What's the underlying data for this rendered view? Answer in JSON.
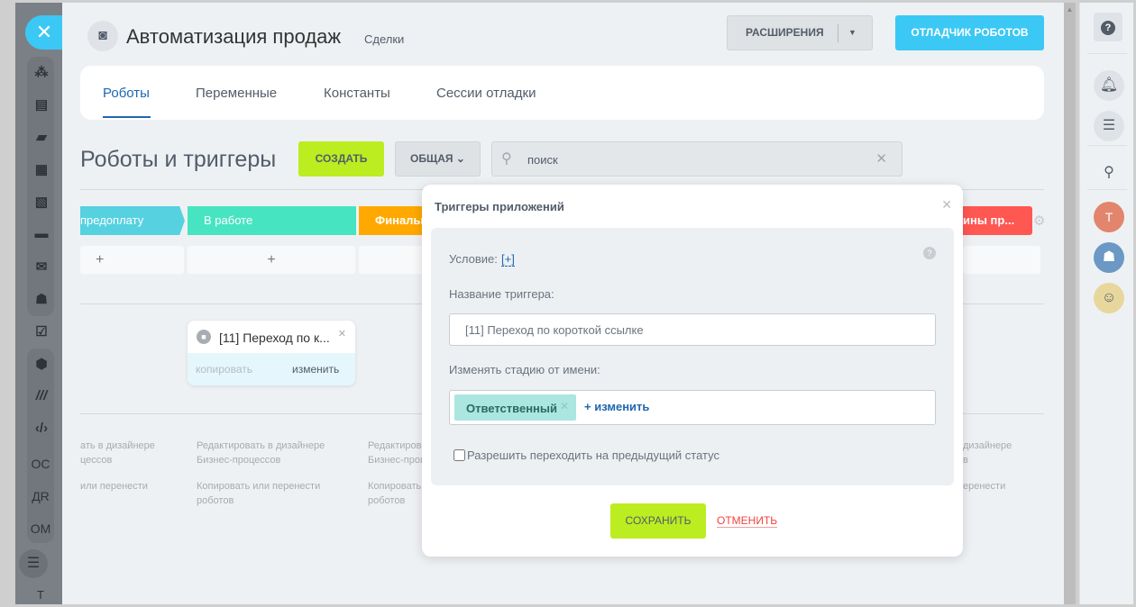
{
  "header": {
    "title": "Автоматизация продаж",
    "subtitle": "Сделки",
    "extensions_label": "РАСШИРЕНИЯ",
    "debugger_label": "ОТЛАДЧИК РОБОТОВ"
  },
  "tabs": [
    {
      "label": "Роботы",
      "active": true
    },
    {
      "label": "Переменные"
    },
    {
      "label": "Константы"
    },
    {
      "label": "Сессии отладки"
    }
  ],
  "toolbar": {
    "heading": "Роботы и триггеры",
    "create_label": "СОЗДАТЬ",
    "filter_label": "ОБЩАЯ",
    "search_placeholder": "поиск"
  },
  "stages": [
    {
      "label": "предоплату",
      "color": "#56d1e0"
    },
    {
      "label": "В работе",
      "color": "#47e4c2"
    },
    {
      "label": "Финальн",
      "color": "#ffa900"
    },
    {
      "label": "ины пр...",
      "color": "#ff5752"
    }
  ],
  "add_symbol": "+",
  "trigger_card": {
    "title": "[11] Переход по к...",
    "copy_label": "копировать",
    "edit_label": "изменить"
  },
  "hints": {
    "edit_designer_1": "Редактировать в дизайнере",
    "edit_designer_2": "Бизнес-процессов",
    "copy_move_1": "Копировать или перенести",
    "copy_move_2": "роботов",
    "left_partial_1": "ать в дизайнере",
    "left_partial_2": "цессов",
    "left_partial_3": "или перенести",
    "mid_partial_1": "Редактирова",
    "mid_partial_2": "Бизнес-проц",
    "mid_partial_3": "Копировать",
    "mid_partial_4": "роботов",
    "right_partial_1": "дизайнере",
    "right_partial_2": "в",
    "right_partial_3": "еренести"
  },
  "left_sidebar": {
    "text_items": [
      "ОС",
      "ДR",
      "ОМ"
    ],
    "bottom_letter": "Т"
  },
  "right_sidebar": {
    "avatar_letter": "T"
  },
  "modal": {
    "title": "Триггеры приложений",
    "condition_label": "Условие:",
    "condition_add": "[+]",
    "name_label": "Название триггера:",
    "name_value": "[11] Переход по короткой ссылке",
    "change_stage_label": "Изменять стадию от имени:",
    "responsible_tag": "Ответственный",
    "change_link": "изменить",
    "allow_prev_label": "Разрешить переходить на предыдущий статус",
    "allow_prev_checked": false,
    "save_label": "СОХРАНИТЬ",
    "cancel_label": "ОТМЕНИТЬ"
  }
}
